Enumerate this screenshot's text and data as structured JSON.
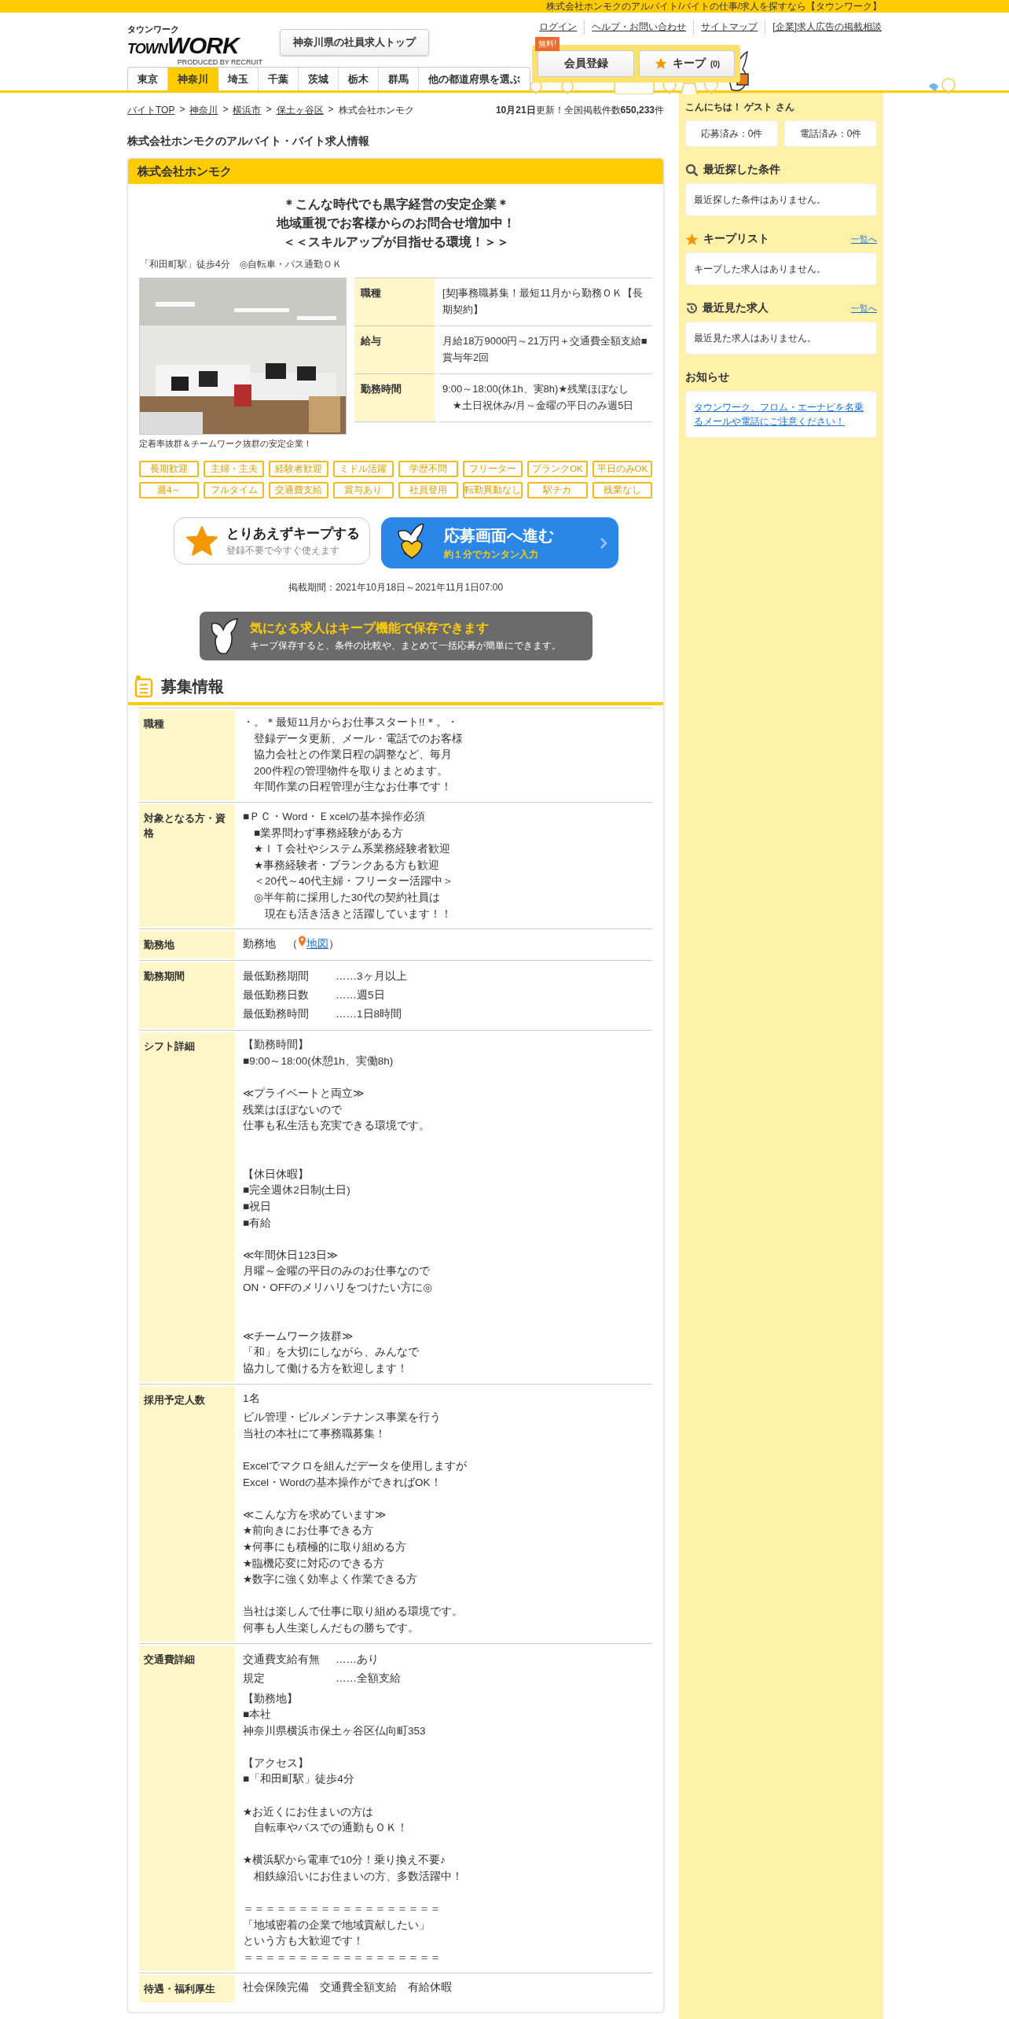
{
  "top_bar": {
    "tagline": "株式会社ホンモクのアルバイト/バイトの仕事/求人を探すなら【タウンワーク】"
  },
  "header": {
    "logo": {
      "kana": "タウンワーク",
      "word1": "TOWN",
      "word2": "WORK",
      "tagline": "PRODUCED BY RECRUIT"
    },
    "top_button": "神奈川県の社員求人トップ",
    "links": [
      "ログイン",
      "ヘルプ・お問い合わせ",
      "サイトマップ",
      "[企業]求人広告の掲載相談"
    ],
    "tabs": [
      {
        "label": "東京",
        "selected": false
      },
      {
        "label": "神奈川",
        "selected": true
      },
      {
        "label": "埼玉",
        "selected": false
      },
      {
        "label": "千葉",
        "selected": false
      },
      {
        "label": "茨城",
        "selected": false
      },
      {
        "label": "栃木",
        "selected": false
      },
      {
        "label": "群馬",
        "selected": false
      },
      {
        "label": "他の都道府県を選ぶ",
        "selected": false
      }
    ],
    "register": {
      "badge": "無料!",
      "label": "会員登録"
    },
    "keep": {
      "label": "キープ",
      "count": "(0)"
    }
  },
  "breadcrumb": {
    "separator": ">",
    "items": [
      "バイトTOP",
      "神奈川",
      "横浜市",
      "保土ヶ谷区"
    ],
    "current": "株式会社ホンモク"
  },
  "update_info": "**10月21日**更新！全国掲載件数**650,233**件",
  "page_title": "株式会社ホンモクのアルバイト・バイト求人情報",
  "card": {
    "company": "株式会社ホンモク",
    "catch": [
      "＊こんな時代でも黒字経営の安定企業＊",
      "地域重視でお客様からのお問合せ増加中！",
      "＜＜スキルアップが目指せる環境！＞＞"
    ],
    "access": "「和田町駅」徒歩4分　◎自転車・バス通勤ＯＫ",
    "photo": {
      "kind": "picture",
      "caption": "定着率抜群＆チームワーク抜群の安定企業！"
    },
    "summary": [
      {
        "label": "職種",
        "lines": [
          "[契]事務職募集！最短11月から勤務ＯＫ【長期契約】"
        ]
      },
      {
        "label": "給与",
        "lines": [
          "月給18万9000円～21万円＋交通費全額支給■賞与年2回"
        ]
      },
      {
        "label": "勤務時間",
        "lines": [
          "9:00～18:00(休1h、実8h)★残業ほぼなし",
          "　★土日祝休み/月～金曜の平日のみ週5日"
        ]
      }
    ],
    "tags": [
      "長期歓迎",
      "主婦・主夫",
      "経験者歓迎",
      "ミドル活躍",
      "学歴不問",
      "フリーター",
      "ブランクOK",
      "平日のみOK",
      "週4～",
      "フルタイム",
      "交通費支給",
      "賞与あり",
      "社員登用",
      "転勤異動なし",
      "駅チカ",
      "残業なし"
    ],
    "keep_button": {
      "title": "とりあえずキープする",
      "sub": "登録不要で今すぐ使えます"
    },
    "apply_button": {
      "title": "応募画面へ進む",
      "sub": "約１分でカンタン入力"
    },
    "period": "掲載期間：2021年10月18日～2021年11月1日07:00",
    "banner": {
      "title": "気になる求人はキープ機能で保存できます",
      "sub": "キープ保存すると、条件の比較や、まとめて一括応募が簡単にできます。"
    }
  },
  "recruit": {
    "title": "募集情報",
    "rows": [
      {
        "label": "職種",
        "parts": [
          {
            "kind": "text",
            "blocks": [
              {
                "lines": [
                  "・。＊最短11月からお仕事スタート!!＊。・",
                  "　登録データ更新、メール・電話でのお客様",
                  "　協力会社との作業日程の調整など、毎月",
                  "　200件程の管理物件を取りまとめます。",
                  "　年間作業の日程管理が主なお仕事です！"
                ]
              }
            ]
          }
        ]
      },
      {
        "label": "対象となる方・資格",
        "parts": [
          {
            "kind": "text",
            "blocks": [
              {
                "lines": [
                  "■ＰＣ・Word・Ｅxcelの基本操作必須",
                  "　■業界問わず事務経験がある方",
                  "　★ＩＴ会社やシステム系業務経験者歓迎",
                  "　★事務経験者・ブランクある方も歓迎",
                  "　＜20代～40代主婦・フリーター活躍中＞",
                  "　◎半年前に採用した30代の契約社員は",
                  "　　現在も活き活きと活躍しています！！"
                ]
              }
            ]
          }
        ]
      },
      {
        "label": "勤務地",
        "parts": [
          {
            "kind": "map",
            "text": "勤務地　（",
            "link": "地図",
            "after": "）"
          }
        ]
      },
      {
        "label": "勤務期間",
        "parts": [
          {
            "kind": "pairs",
            "items": [
              [
                "最低勤務期間",
                "……3ヶ月以上"
              ],
              [
                "最低勤務日数",
                "……週5日"
              ],
              [
                "最低勤務時間",
                "……1日8時間"
              ]
            ]
          }
        ]
      },
      {
        "label": "シフト詳細",
        "parts": [
          {
            "kind": "text",
            "blocks": [
              {
                "lines": [
                  "【勤務時間】",
                  "■9:00～18:00(休憩1h、実働8h)"
                ]
              },
              {
                "lines": [
                  "≪プライベートと両立≫",
                  "残業はほぼないので",
                  "仕事も私生活も充実できる環境です。"
                ]
              },
              {
                "lines": [
                  "【休日休暇】",
                  "■完全週休2日制(土日)",
                  "■祝日",
                  "■有給"
                ],
                "extra_space": true
              },
              {
                "lines": [
                  "≪年間休日123日≫",
                  "月曜～金曜の平日のみのお仕事なので",
                  "ON・OFFのメリハリをつけたい方に◎"
                ]
              },
              {
                "lines": [
                  "≪チームワーク抜群≫",
                  "「和」を大切にしながら、みんなで",
                  "協力して働ける方を歓迎します！"
                ],
                "extra_space": true
              }
            ]
          }
        ]
      },
      {
        "label": "採用予定人数",
        "parts": [
          {
            "kind": "text",
            "blocks": [
              {
                "lines": [
                  "1名"
                ]
              }
            ]
          },
          {
            "kind": "text",
            "blocks": [
              {
                "lines": [
                  "ビル管理・ビルメンテナンス事業を行う",
                  "当社の本社にて事務職募集！"
                ]
              },
              {
                "lines": [
                  "Excelでマクロを組んだデータを使用しますが",
                  "Excel・Wordの基本操作ができればOK！"
                ]
              },
              {
                "lines": [
                  "≪こんな方を求めています≫",
                  "★前向きにお仕事できる方",
                  "★何事にも積極的に取り組める方",
                  "★臨機応変に対応のできる方",
                  "★数字に強く効率よく作業できる方"
                ]
              },
              {
                "lines": [
                  "当社は楽しんで仕事に取り組める環境です。",
                  "何事も人生楽しんだもの勝ちです。"
                ]
              }
            ]
          }
        ]
      },
      {
        "label": "交通費詳細",
        "parts": [
          {
            "kind": "pairs",
            "items": [
              [
                "交通費支給有無",
                "……あり"
              ],
              [
                "規定",
                "……全額支給"
              ]
            ]
          },
          {
            "kind": "text",
            "blocks": [
              {
                "lines": [
                  "【勤務地】",
                  "■本社",
                  "神奈川県横浜市保土ヶ谷区仏向町353"
                ]
              },
              {
                "lines": [
                  "【アクセス】",
                  "■「和田町駅」徒歩4分"
                ]
              },
              {
                "lines": [
                  "★お近くにお住まいの方は",
                  "　自転車やバスでの通勤もＯＫ！"
                ]
              },
              {
                "lines": [
                  "★横浜駅から電車で10分！乗り換え不要♪",
                  "　相鉄線沿いにお住まいの方、多数活躍中！"
                ]
              },
              {
                "lines": [
                  "＝＝＝＝＝＝＝＝＝＝＝＝＝＝＝＝＝＝",
                  "「地域密着の企業で地域貢献したい」",
                  "という方も大歓迎です！",
                  "＝＝＝＝＝＝＝＝＝＝＝＝＝＝＝＝＝＝"
                ]
              }
            ]
          }
        ]
      },
      {
        "label": "待遇・福利厚生",
        "parts": [
          {
            "kind": "text",
            "blocks": [
              {
                "lines": [
                  "社会保険完備　交通費全額支給　有給休暇"
                ]
              }
            ]
          }
        ]
      }
    ]
  },
  "sidebar": {
    "greeting": "こんにちは！ **ゲスト** さん",
    "counters": [
      "応募済み：0件",
      "電話済み：0件"
    ],
    "sections": [
      {
        "kind": "search",
        "title": "最近探した条件",
        "body": "最近探した条件はありません。"
      },
      {
        "kind": "keep",
        "title": "キープリスト",
        "link": "一覧へ",
        "body": "キープした求人はありません。"
      },
      {
        "kind": "history",
        "title": "最近見た求人",
        "link": "一覧へ",
        "body": "最近見た求人はありません。"
      },
      {
        "kind": "notice",
        "title": "お知らせ",
        "notice_link": "タウンワーク、フロム・エーナビを名乗るメールや電話にご注意ください！"
      }
    ]
  }
}
